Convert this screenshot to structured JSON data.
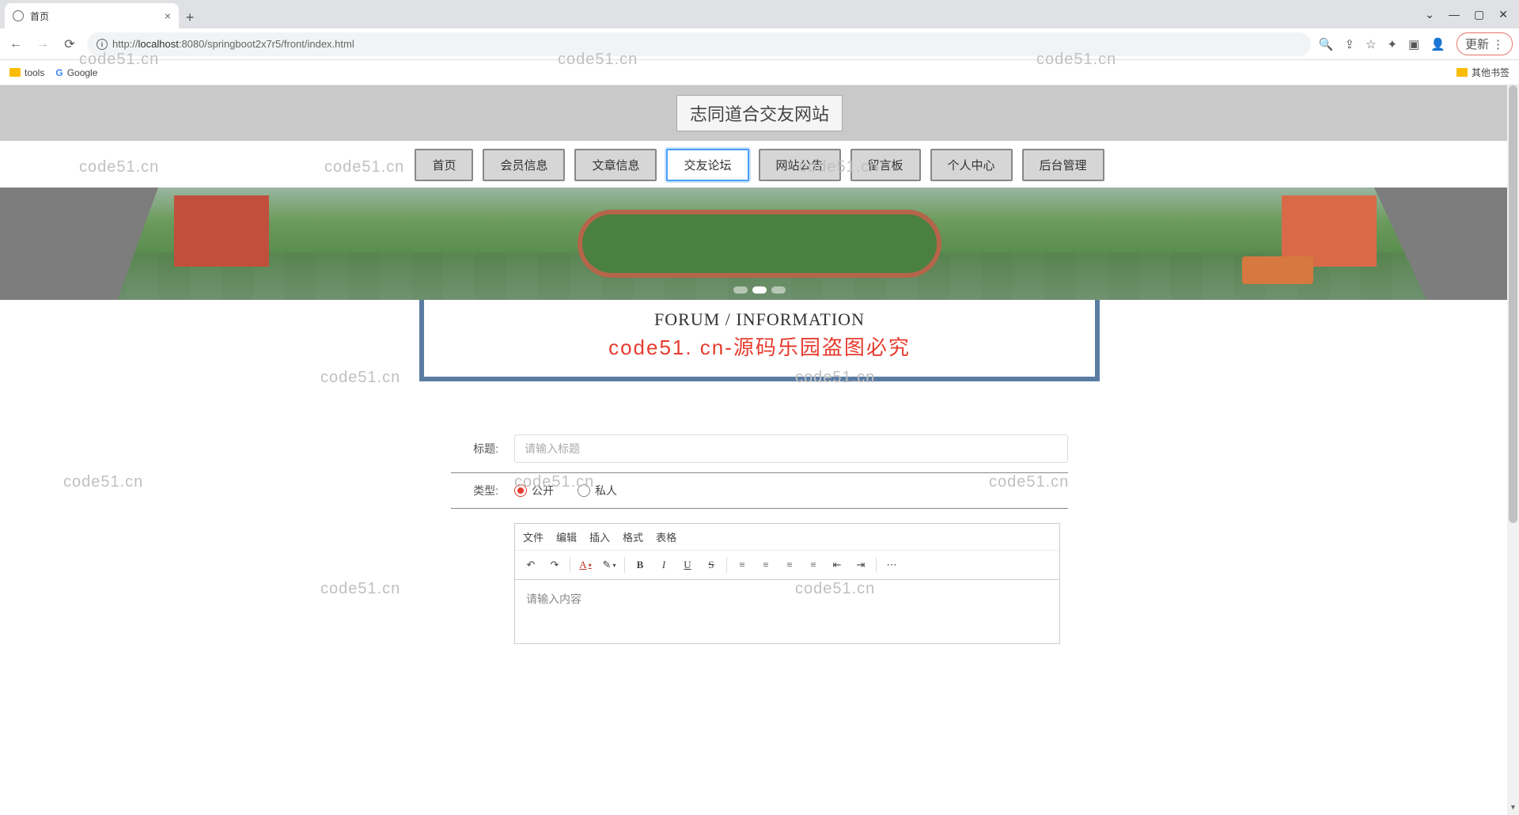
{
  "browser": {
    "tab_title": "首页",
    "url_host": "localhost",
    "url_port": ":8080",
    "url_path": "/springboot2x7r5/front/index.html",
    "url_scheme": "http://",
    "update_label": "更新",
    "bookmarks": {
      "tools": "tools",
      "google": "Google",
      "other": "其他书签"
    }
  },
  "site": {
    "title": "志同道合交友网站",
    "nav": [
      "首页",
      "会员信息",
      "文章信息",
      "交友论坛",
      "网站公告",
      "留言板",
      "个人中心",
      "后台管理"
    ],
    "nav_active_index": 3
  },
  "heading": {
    "en": "FORUM / INFORMATION",
    "red": "code51. cn-源码乐园盗图必究"
  },
  "form": {
    "title_label": "标题:",
    "title_placeholder": "请输入标题",
    "type_label": "类型:",
    "type_options": [
      "公开",
      "私人"
    ],
    "type_checked_index": 0
  },
  "editor": {
    "menu": [
      "文件",
      "编辑",
      "插入",
      "格式",
      "表格"
    ],
    "placeholder": "请输入内容"
  },
  "watermarks": {
    "text": "code51.cn"
  }
}
